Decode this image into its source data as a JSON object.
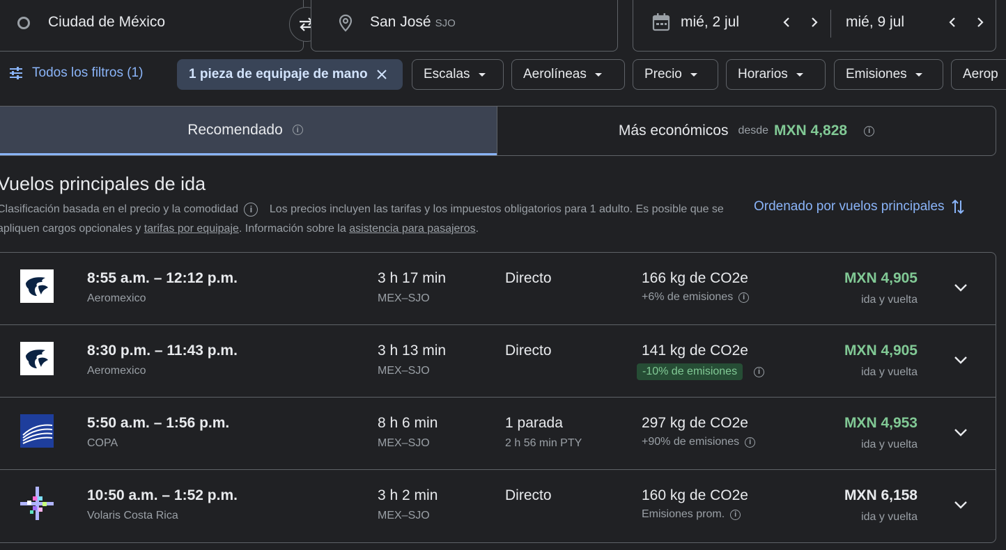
{
  "search": {
    "origin": "Ciudad de México",
    "destination": "San José",
    "destination_code": "SJO",
    "depart_date": "mié, 2 jul",
    "return_date": "mié, 9 jul"
  },
  "filters": {
    "all_filters": "Todos los filtros (1)",
    "active_chip": "1 pieza de equipaje de mano",
    "chips": [
      "Escalas",
      "Aerolíneas",
      "Precio",
      "Horarios",
      "Emisiones",
      "Aerop"
    ]
  },
  "tabs": {
    "recommended": "Recomendado",
    "cheapest": "Más económicos",
    "from_label": "desde",
    "cheapest_price": "MXN 4,828"
  },
  "section": {
    "title": "Vuelos principales de ida",
    "ranking_note": "Clasificación basada en el precio y la comodidad",
    "price_note_1": "Los precios incluyen las tarifas y los impuestos obligatorios para 1 adulto. Es posible que se apliquen cargos opcionales y",
    "bag_fees_link": "tarifas por equipaje",
    "price_note_2": ". Información sobre la",
    "assistance_link": "asistencia para pasajeros",
    "price_note_3": ".",
    "sort_label": "Ordenado por vuelos principales"
  },
  "flights": [
    {
      "times": "8:55 a.m. – 12:12 p.m.",
      "airline": "Aeromexico",
      "duration": "3 h 17 min",
      "route": "MEX–SJO",
      "stops": "Directo",
      "layover": "",
      "co2": "166 kg de CO2e",
      "emissions": "+6% de emisiones",
      "price": "MXN 4,905",
      "trip": "ida y vuelta"
    },
    {
      "times": "8:30 p.m. – 11:43 p.m.",
      "airline": "Aeromexico",
      "duration": "3 h 13 min",
      "route": "MEX–SJO",
      "stops": "Directo",
      "layover": "",
      "co2": "141 kg de CO2e",
      "emissions": "-10% de emisiones",
      "price": "MXN 4,905",
      "trip": "ida y vuelta"
    },
    {
      "times": "5:50 a.m. – 1:56 p.m.",
      "airline": "COPA",
      "duration": "8 h 6 min",
      "route": "MEX–SJO",
      "stops": "1 parada",
      "layover": "2 h 56 min PTY",
      "co2": "297 kg de CO2e",
      "emissions": "+90% de emisiones",
      "price": "MXN 4,953",
      "trip": "ida y vuelta"
    },
    {
      "times": "10:50 a.m. – 1:52 p.m.",
      "airline": "Volaris Costa Rica",
      "duration": "3 h 2 min",
      "route": "MEX–SJO",
      "stops": "Directo",
      "layover": "",
      "co2": "160 kg de CO2e",
      "emissions": "Emisiones prom.",
      "price": "MXN 6,158",
      "trip": "ida y vuelta"
    }
  ],
  "colors": {
    "background": "#202124",
    "accent_blue": "#8ab4f8",
    "price_green": "#81c995",
    "border": "#5f6368"
  }
}
